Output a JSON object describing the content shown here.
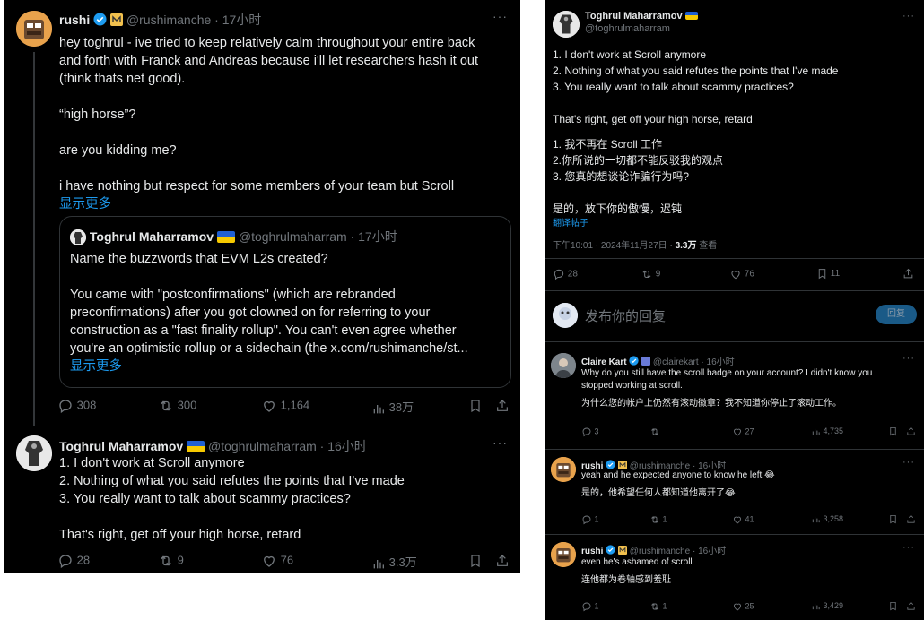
{
  "left": {
    "tweet1": {
      "name": "rushi",
      "handle_time": "@rushimanche · 17小时",
      "text": [
        "hey toghrul - ive tried to keep relatively calm throughout your entire back",
        "and forth with Franck and Andreas because i'll let researchers hash it out",
        "(think thats net good).",
        "“high horse”?",
        "are you kidding me?",
        "i have nothing but respect for some members of your team but Scroll"
      ],
      "show_more": "显示更多",
      "more": "···",
      "quote": {
        "name": "Toghrul Maharramov",
        "handle_time": "@toghrulmaharram · 17小时",
        "lines": [
          "Name the buzzwords that EVM L2s created?",
          "You came with \"postconfirmations\" (which are rebranded",
          "preconfirmations) after you got clowned on for referring to your",
          "construction as a \"fast finality rollup\". You can't even agree whether",
          "you're an optimistic rollup or a sidechain (the x.com/rushimanche/st..."
        ],
        "show_more": "显示更多"
      },
      "actions": {
        "reply": "308",
        "retweet": "300",
        "like": "1,164",
        "views": "38万"
      }
    },
    "tweet2": {
      "name": "Toghrul Maharramov",
      "handle_time": "@toghrulmaharram · 16小时",
      "more": "···",
      "lines": [
        "1. I don't work at Scroll anymore",
        "2. Nothing of what you said refutes the points that I've made",
        "3. You really want to talk about scammy practices?",
        "That's right, get off your high horse, retard"
      ],
      "actions": {
        "reply": "28",
        "retweet": "9",
        "like": "76",
        "views": "3.3万"
      }
    }
  },
  "right": {
    "main": {
      "name": "Toghrul Maharramov",
      "handle": "@toghrulmaharram",
      "more": "···",
      "lines_en": [
        "1. I don't work at Scroll anymore",
        "2. Nothing of what you said refutes the points that I've made",
        "3. You really want to talk about scammy practices?",
        "That's right, get off your high horse, retard"
      ],
      "lines_zh": [
        "1. 我不再在 Scroll 工作",
        "2.你所说的一切都不能反驳我的观点",
        "3. 您真的想谈论诈骗行为吗?",
        "是的，放下你的傲慢，迟钝"
      ],
      "translate": "翻译帖子",
      "meta_time": "下午10:01 · 2024年11月27日 · ",
      "meta_views": "3.3万",
      "meta_views_label": " 查看",
      "actions": {
        "reply": "28",
        "retweet": "9",
        "like": "76",
        "bookmark": "11"
      }
    },
    "reply_box": {
      "placeholder": "发布你的回复",
      "button": "回复"
    },
    "replies": [
      {
        "name": "Claire Kart",
        "handle_time": "@clairekart · 16小时",
        "lines": [
          "Why do you still have the scroll badge on your account? I didn't know you",
          "stopped working at scroll.",
          "为什么您的帐户上仍然有滚动徽章？我不知道你停止了滚动工作。"
        ],
        "actions": {
          "reply": "3",
          "retweet": "",
          "like": "27",
          "views": "4,735"
        }
      },
      {
        "name": "rushi",
        "handle_time": "@rushimanche · 16小时",
        "lines": [
          "yeah and he expected anyone to know he left 😂",
          "是的，他希望任何人都知道他离开了😂"
        ],
        "actions": {
          "reply": "1",
          "retweet": "1",
          "like": "41",
          "views": "3,258"
        }
      },
      {
        "name": "rushi",
        "handle_time": "@rushimanche · 16小时",
        "lines": [
          "even he's ashamed of scroll",
          "连他都为卷轴感到羞耻"
        ],
        "actions": {
          "reply": "1",
          "retweet": "1",
          "like": "25",
          "views": "3,429"
        }
      }
    ]
  },
  "colors": {
    "bg": "#000000",
    "text": "#e7e9ea",
    "muted": "#71767b",
    "accent": "#1d9bf0",
    "border": "#2f3336"
  }
}
